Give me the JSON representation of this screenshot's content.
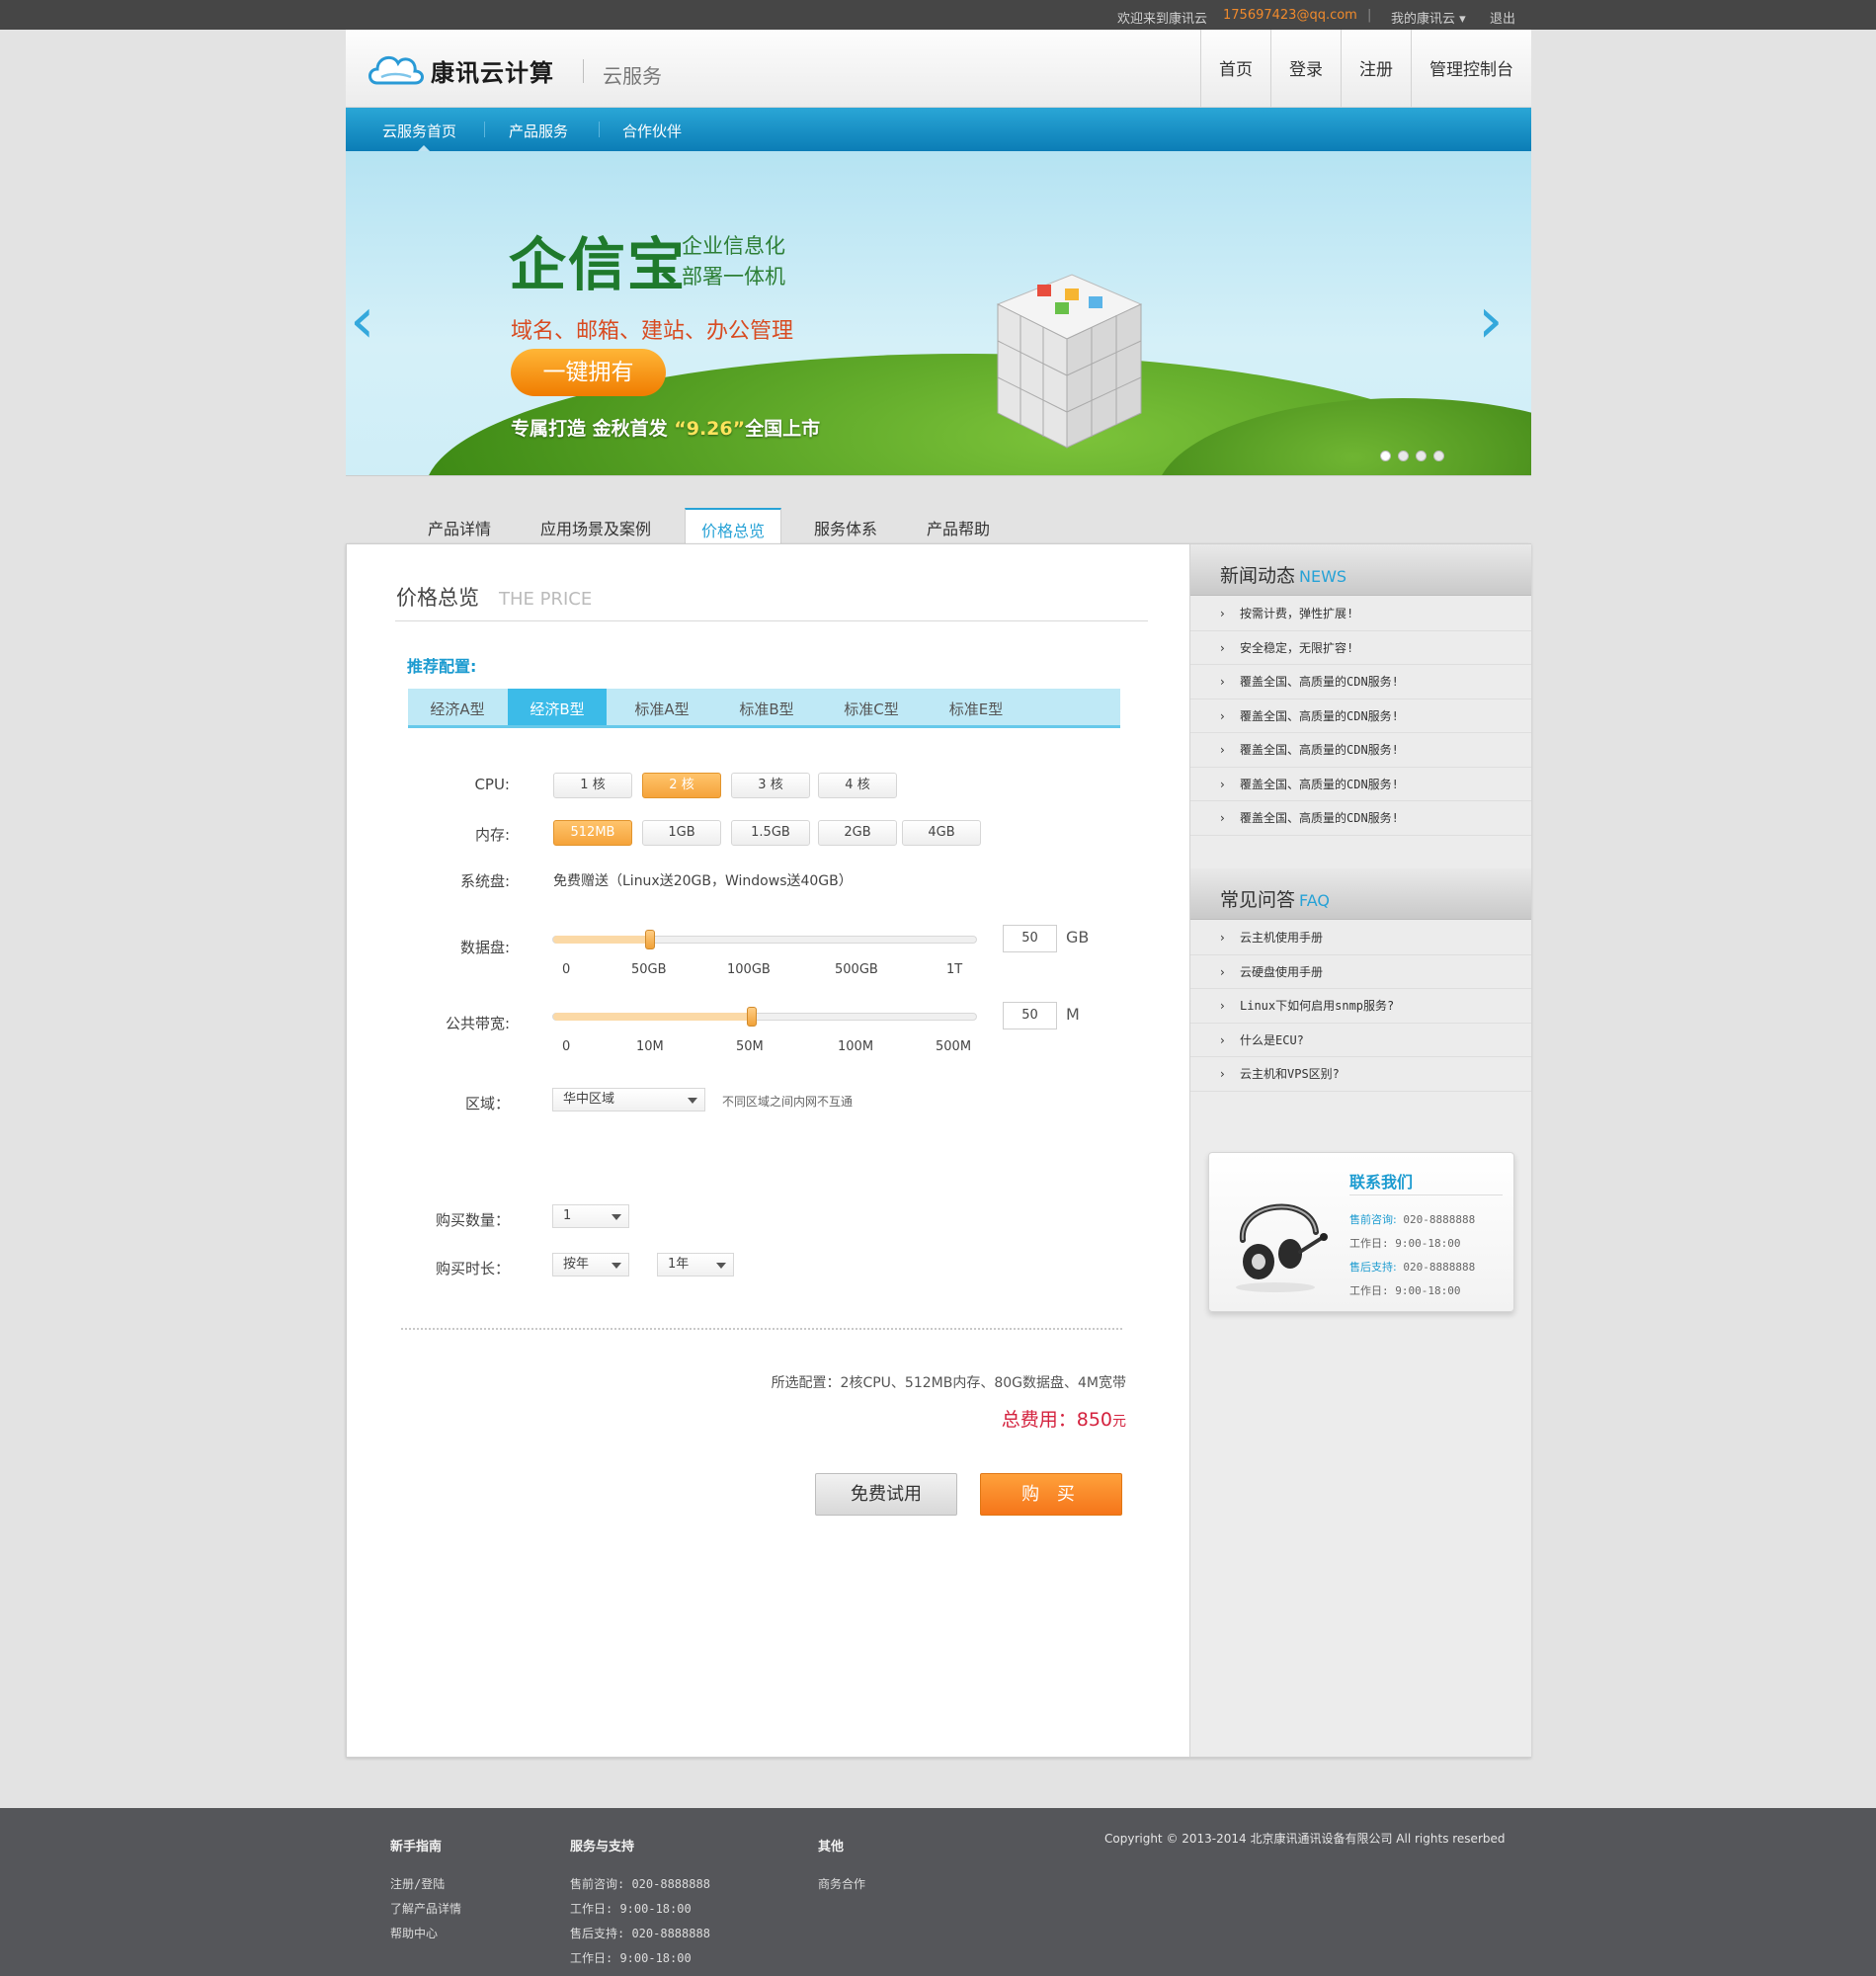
{
  "topbar": {
    "welcome": "欢迎来到康讯云",
    "email": "175697423@qq.com",
    "sep": "|",
    "my_account": "我的康讯云 ▾",
    "logout": "退出"
  },
  "header": {
    "brand": "康讯云计算",
    "subtitle": "云服务",
    "nav": [
      "首页",
      "登录",
      "注册",
      "管理控制台"
    ]
  },
  "bluenav": {
    "items": [
      "云服务首页",
      "产品服务",
      "合作伙伴"
    ]
  },
  "banner": {
    "title": "企信宝",
    "sub1": "企业信息化",
    "sub2": "部署一体机",
    "line": "域名、邮箱、建站、办公管理",
    "button": "一键拥有",
    "tag_a": "专属打造  金秋首发 ",
    "tag_b": "“9.26”",
    "tag_c": "全国上市",
    "prev": "‹",
    "next": "›"
  },
  "tabs": [
    "产品详情",
    "应用场景及案例",
    "价格总览",
    "服务体系",
    "产品帮助"
  ],
  "price": {
    "title": "价格总览",
    "title_en": "THE PRICE",
    "recommend_label": "推荐配置:",
    "preset_tabs": [
      "经济A型",
      "经济B型",
      "标准A型",
      "标准B型",
      "标准C型",
      "标准E型"
    ],
    "cpu_label": "CPU:",
    "cpu_options": [
      "1 核",
      "2 核",
      "3 核",
      "4 核"
    ],
    "mem_label": "内存:",
    "mem_options": [
      "512MB",
      "1GB",
      "1.5GB",
      "2GB",
      "4GB"
    ],
    "sysdisk_label": "系统盘:",
    "sysdisk_text": "免费赠送（Linux送20GB，Windows送40GB）",
    "datadisk_label": "数据盘:",
    "datadisk_ticks": [
      "0",
      "50GB",
      "100GB",
      "500GB",
      "1T"
    ],
    "datadisk_value": "50",
    "datadisk_unit": "GB",
    "datadisk_level": 0.23,
    "bw_label": "公共带宽:",
    "bw_ticks": [
      "0",
      "10M",
      "50M",
      "100M",
      "500M"
    ],
    "bw_value": "50",
    "bw_unit": "M",
    "bw_level": 0.47,
    "region_label": "区域：",
    "region_value": "华中区域",
    "region_note": "不同区域之间内网不互通",
    "qty_label": "购买数量：",
    "qty_value": "1",
    "duration_label": "购买时长：",
    "duration_unit": "按年",
    "duration_value": "1年",
    "summary": "所选配置：2核CPU、512MB内存、80G数据盘、4M宽带",
    "total_label": "总费用：",
    "total_value": "850",
    "total_unit": "元",
    "trial_button": "免费试用",
    "buy_button": "购  买"
  },
  "news": {
    "title": "新闻动态",
    "title_en": "NEWS",
    "items": [
      "按需计费，弹性扩展!",
      "安全稳定，无限扩容!",
      "覆盖全国、高质量的CDN服务!",
      "覆盖全国、高质量的CDN服务!",
      "覆盖全国、高质量的CDN服务!",
      "覆盖全国、高质量的CDN服务!",
      "覆盖全国、高质量的CDN服务!"
    ]
  },
  "faq": {
    "title": "常见问答",
    "title_en": "FAQ",
    "items": [
      "云主机使用手册",
      "云硬盘使用手册",
      "Linux下如何启用snmp服务?",
      "什么是ECU?",
      "云主机和VPS区别?"
    ]
  },
  "contact": {
    "title": "联系我们",
    "presale_label": "售前咨询:",
    "presale_phone": "020-8888888",
    "hours1": "工作日: 9:00-18:00",
    "aftersale_label": "售后支持:",
    "aftersale_phone": "020-8888888",
    "hours2": "工作日: 9:00-18:00"
  },
  "footer": {
    "col1_title": "新手指南",
    "col1_items": [
      "注册/登陆",
      "了解产品详情",
      "帮助中心"
    ],
    "col2_title": "服务与支持",
    "col2_items": [
      "售前咨询: 020-8888888",
      "工作日: 9:00-18:00",
      "售后支持: 020-8888888",
      "工作日: 9:00-18:00"
    ],
    "col3_title": "其他",
    "col3_items": [
      "商务合作"
    ],
    "copyright": "Copyright © 2013-2014  北京康讯通讯设备有限公司   All rights reserbed"
  },
  "colors": {
    "accent": "#27a2d6",
    "orange": "#f5a33a",
    "price_red": "#d4223e"
  }
}
